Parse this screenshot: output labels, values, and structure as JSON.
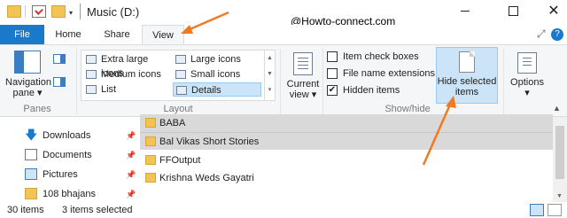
{
  "window": {
    "title": "Music (D:)",
    "watermark": "@Howto-connect.com",
    "dropdown_glyph": "▾",
    "minimize_label": "",
    "maximize_label": "",
    "close_label": "✕"
  },
  "tabs": [
    {
      "label": "File"
    },
    {
      "label": "Home"
    },
    {
      "label": "Share"
    },
    {
      "label": "View"
    }
  ],
  "ribbon_right": {
    "pin_glyph": "⤢",
    "help_glyph": "?"
  },
  "ribbon": {
    "panes": {
      "navigation_pane_label": "Navigation pane ▾",
      "group_label": "Panes"
    },
    "layout": {
      "items": [
        {
          "label": "Extra large icons"
        },
        {
          "label": "Medium icons"
        },
        {
          "label": "List"
        },
        {
          "label": "Large icons"
        },
        {
          "label": "Small icons"
        },
        {
          "label": "Details"
        }
      ],
      "scroll_glyphs": [
        "▲",
        "▼",
        "▾"
      ],
      "group_label": "Layout"
    },
    "current_view": {
      "label": "Current view ▾"
    },
    "show_hide": {
      "checkboxes": [
        {
          "label": "Item check boxes",
          "checked": false
        },
        {
          "label": "File name extensions",
          "checked": false
        },
        {
          "label": "Hidden items",
          "checked": true
        }
      ],
      "hide_selected_label": "Hide selected items",
      "group_label": "Show/hide"
    },
    "options": {
      "label": "Options ▾"
    },
    "collapse_glyph": "▲"
  },
  "nav": {
    "items": [
      {
        "label": "Downloads",
        "icon": "download-icon"
      },
      {
        "label": "Documents",
        "icon": "documents-icon"
      },
      {
        "label": "Pictures",
        "icon": "pictures-icon"
      },
      {
        "label": "108 bhajans",
        "icon": "folder-icon"
      }
    ],
    "pin_glyph": "📌"
  },
  "files": [
    {
      "name": "BABA",
      "selected": true
    },
    {
      "name": "Bal Vikas Short Stories",
      "selected": true
    },
    {
      "name": "FFOutput",
      "selected": false
    },
    {
      "name": "Krishna Weds Gayatri",
      "selected": false
    }
  ],
  "status": {
    "item_count": "30 items",
    "selected_count": "3 items selected"
  },
  "colors": {
    "accent": "#1979ca",
    "selection": "#cce4f7",
    "annotation_arrow": "#f07a22"
  }
}
